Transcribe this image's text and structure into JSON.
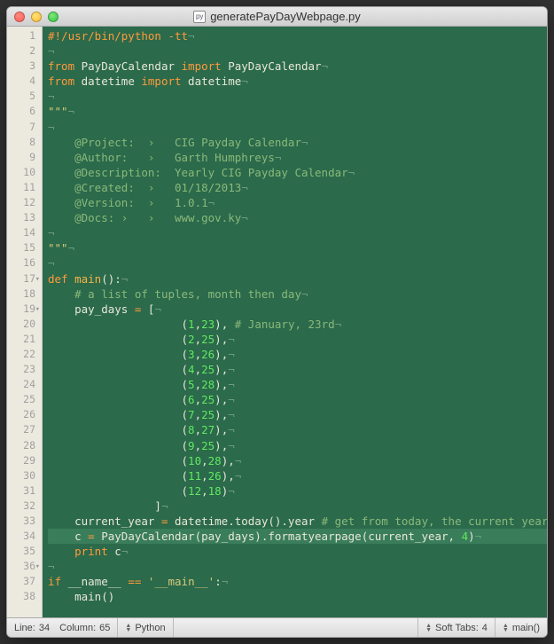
{
  "window": {
    "filename": "generatePayDayWebpage.py"
  },
  "status": {
    "line_label": "Line:",
    "line_value": "34",
    "col_label": "Column:",
    "col_value": "65",
    "language": "Python",
    "soft_tabs_label": "Soft Tabs:",
    "soft_tabs_value": "4",
    "symbol": "main()"
  },
  "code": {
    "lines": [
      {
        "n": 1,
        "seg": [
          {
            "c": "kw",
            "t": "#!/usr/bin/python -tt"
          },
          {
            "c": "dim",
            "t": "¬"
          }
        ]
      },
      {
        "n": 2,
        "seg": [
          {
            "c": "dim",
            "t": "¬"
          }
        ]
      },
      {
        "n": 3,
        "seg": [
          {
            "c": "kw",
            "t": "from"
          },
          {
            "t": " PayDayCalendar "
          },
          {
            "c": "kw",
            "t": "import"
          },
          {
            "t": " PayDayCalendar"
          },
          {
            "c": "dim",
            "t": "¬"
          }
        ]
      },
      {
        "n": 4,
        "seg": [
          {
            "c": "kw",
            "t": "from"
          },
          {
            "t": " datetime "
          },
          {
            "c": "kw",
            "t": "import"
          },
          {
            "t": " datetime"
          },
          {
            "c": "dim",
            "t": "¬"
          }
        ]
      },
      {
        "n": 5,
        "seg": [
          {
            "c": "dim",
            "t": "¬"
          }
        ]
      },
      {
        "n": 6,
        "seg": [
          {
            "c": "str",
            "t": "\"\"\""
          },
          {
            "c": "dim",
            "t": "¬"
          }
        ]
      },
      {
        "n": 7,
        "seg": [
          {
            "c": "dim",
            "t": "¬"
          }
        ]
      },
      {
        "n": 8,
        "seg": [
          {
            "t": "    "
          },
          {
            "c": "comment",
            "t": "@Project:  ›   CIG Payday Calendar"
          },
          {
            "c": "dim",
            "t": "¬"
          }
        ]
      },
      {
        "n": 9,
        "seg": [
          {
            "t": "    "
          },
          {
            "c": "comment",
            "t": "@Author:   ›   Garth Humphreys"
          },
          {
            "c": "dim",
            "t": "¬"
          }
        ]
      },
      {
        "n": 10,
        "seg": [
          {
            "t": "    "
          },
          {
            "c": "comment",
            "t": "@Description:  Yearly CIG Payday Calendar"
          },
          {
            "c": "dim",
            "t": "¬"
          }
        ]
      },
      {
        "n": 11,
        "seg": [
          {
            "t": "    "
          },
          {
            "c": "comment",
            "t": "@Created:  ›   01/18/2013"
          },
          {
            "c": "dim",
            "t": "¬"
          }
        ]
      },
      {
        "n": 12,
        "seg": [
          {
            "t": "    "
          },
          {
            "c": "comment",
            "t": "@Version:  ›   1.0.1"
          },
          {
            "c": "dim",
            "t": "¬"
          }
        ]
      },
      {
        "n": 13,
        "seg": [
          {
            "t": "    "
          },
          {
            "c": "comment",
            "t": "@Docs: ›   ›   www.gov.ky"
          },
          {
            "c": "dim",
            "t": "¬"
          }
        ]
      },
      {
        "n": 14,
        "seg": [
          {
            "c": "dim",
            "t": "¬"
          }
        ]
      },
      {
        "n": 15,
        "seg": [
          {
            "c": "str",
            "t": "\"\"\""
          },
          {
            "c": "dim",
            "t": "¬"
          }
        ]
      },
      {
        "n": 16,
        "seg": [
          {
            "c": "dim",
            "t": "¬"
          }
        ]
      },
      {
        "n": 17,
        "fold": true,
        "seg": [
          {
            "c": "kw",
            "t": "def"
          },
          {
            "t": " "
          },
          {
            "c": "fn",
            "t": "main"
          },
          {
            "t": "():"
          },
          {
            "c": "dim",
            "t": "¬"
          }
        ]
      },
      {
        "n": 18,
        "seg": [
          {
            "t": "    "
          },
          {
            "c": "comment",
            "t": "# a list of tuples, month then day"
          },
          {
            "c": "dim",
            "t": "¬"
          }
        ]
      },
      {
        "n": 19,
        "fold": true,
        "seg": [
          {
            "t": "    pay_days "
          },
          {
            "c": "kw",
            "t": "="
          },
          {
            "t": " ["
          },
          {
            "c": "dim",
            "t": "¬"
          }
        ]
      },
      {
        "n": 20,
        "seg": [
          {
            "t": "                    ("
          },
          {
            "c": "num",
            "t": "1"
          },
          {
            "t": ","
          },
          {
            "c": "num",
            "t": "23"
          },
          {
            "t": "), "
          },
          {
            "c": "comment",
            "t": "# January, 23rd"
          },
          {
            "c": "dim",
            "t": "¬"
          }
        ]
      },
      {
        "n": 21,
        "seg": [
          {
            "t": "                    ("
          },
          {
            "c": "num",
            "t": "2"
          },
          {
            "t": ","
          },
          {
            "c": "num",
            "t": "25"
          },
          {
            "t": "),"
          },
          {
            "c": "dim",
            "t": "¬"
          }
        ]
      },
      {
        "n": 22,
        "seg": [
          {
            "t": "                    ("
          },
          {
            "c": "num",
            "t": "3"
          },
          {
            "t": ","
          },
          {
            "c": "num",
            "t": "26"
          },
          {
            "t": "),"
          },
          {
            "c": "dim",
            "t": "¬"
          }
        ]
      },
      {
        "n": 23,
        "seg": [
          {
            "t": "                    ("
          },
          {
            "c": "num",
            "t": "4"
          },
          {
            "t": ","
          },
          {
            "c": "num",
            "t": "25"
          },
          {
            "t": "),"
          },
          {
            "c": "dim",
            "t": "¬"
          }
        ]
      },
      {
        "n": 24,
        "seg": [
          {
            "t": "                    ("
          },
          {
            "c": "num",
            "t": "5"
          },
          {
            "t": ","
          },
          {
            "c": "num",
            "t": "28"
          },
          {
            "t": "),"
          },
          {
            "c": "dim",
            "t": "¬"
          }
        ]
      },
      {
        "n": 25,
        "seg": [
          {
            "t": "                    ("
          },
          {
            "c": "num",
            "t": "6"
          },
          {
            "t": ","
          },
          {
            "c": "num",
            "t": "25"
          },
          {
            "t": "),"
          },
          {
            "c": "dim",
            "t": "¬"
          }
        ]
      },
      {
        "n": 26,
        "seg": [
          {
            "t": "                    ("
          },
          {
            "c": "num",
            "t": "7"
          },
          {
            "t": ","
          },
          {
            "c": "num",
            "t": "25"
          },
          {
            "t": "),"
          },
          {
            "c": "dim",
            "t": "¬"
          }
        ]
      },
      {
        "n": 27,
        "seg": [
          {
            "t": "                    ("
          },
          {
            "c": "num",
            "t": "8"
          },
          {
            "t": ","
          },
          {
            "c": "num",
            "t": "27"
          },
          {
            "t": "),"
          },
          {
            "c": "dim",
            "t": "¬"
          }
        ]
      },
      {
        "n": 28,
        "seg": [
          {
            "t": "                    ("
          },
          {
            "c": "num",
            "t": "9"
          },
          {
            "t": ","
          },
          {
            "c": "num",
            "t": "25"
          },
          {
            "t": "),"
          },
          {
            "c": "dim",
            "t": "¬"
          }
        ]
      },
      {
        "n": 29,
        "seg": [
          {
            "t": "                    ("
          },
          {
            "c": "num",
            "t": "10"
          },
          {
            "t": ","
          },
          {
            "c": "num",
            "t": "28"
          },
          {
            "t": "),"
          },
          {
            "c": "dim",
            "t": "¬"
          }
        ]
      },
      {
        "n": 30,
        "seg": [
          {
            "t": "                    ("
          },
          {
            "c": "num",
            "t": "11"
          },
          {
            "t": ","
          },
          {
            "c": "num",
            "t": "26"
          },
          {
            "t": "),"
          },
          {
            "c": "dim",
            "t": "¬"
          }
        ]
      },
      {
        "n": 31,
        "seg": [
          {
            "t": "                    ("
          },
          {
            "c": "num",
            "t": "12"
          },
          {
            "t": ","
          },
          {
            "c": "num",
            "t": "18"
          },
          {
            "t": ")"
          },
          {
            "c": "dim",
            "t": "¬"
          }
        ]
      },
      {
        "n": 32,
        "seg": [
          {
            "t": "                ]"
          },
          {
            "c": "dim",
            "t": "¬"
          }
        ]
      },
      {
        "n": 33,
        "seg": [
          {
            "t": "    current_year "
          },
          {
            "c": "kw",
            "t": "="
          },
          {
            "t": " datetime.today().year "
          },
          {
            "c": "comment",
            "t": "# get from today, the current year"
          },
          {
            "c": "dim",
            "t": "¬"
          }
        ]
      },
      {
        "n": 34,
        "hl": true,
        "seg": [
          {
            "t": "    c "
          },
          {
            "c": "kw",
            "t": "="
          },
          {
            "t": " PayDayCalendar(pay_days).formatyearpage(current_year, "
          },
          {
            "c": "num",
            "t": "4"
          },
          {
            "t": ")"
          },
          {
            "c": "dim",
            "t": "¬"
          }
        ]
      },
      {
        "n": 35,
        "seg": [
          {
            "t": "    "
          },
          {
            "c": "kw",
            "t": "print"
          },
          {
            "t": " c"
          },
          {
            "c": "dim",
            "t": "¬"
          }
        ]
      },
      {
        "n": 36,
        "fold": true,
        "seg": [
          {
            "c": "dim",
            "t": "¬"
          }
        ]
      },
      {
        "n": 37,
        "seg": [
          {
            "c": "kw",
            "t": "if"
          },
          {
            "t": " __name__ "
          },
          {
            "c": "kw",
            "t": "=="
          },
          {
            "t": " "
          },
          {
            "c": "str",
            "t": "'__main__'"
          },
          {
            "t": ":"
          },
          {
            "c": "dim",
            "t": "¬"
          }
        ]
      },
      {
        "n": 38,
        "seg": [
          {
            "t": "    main()"
          }
        ]
      }
    ]
  }
}
